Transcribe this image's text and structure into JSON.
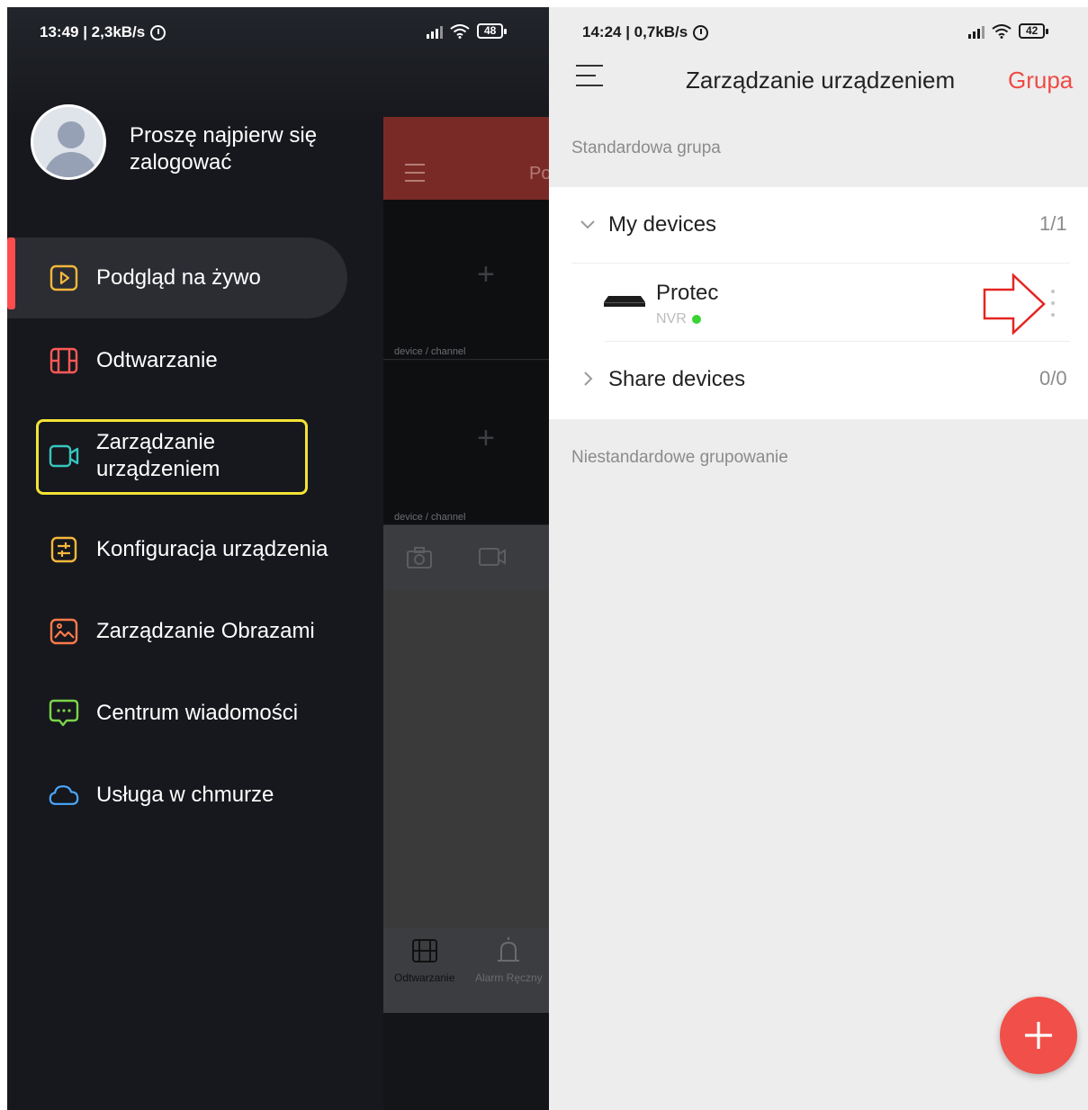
{
  "left_phone": {
    "status": {
      "time": "13:49 | 2,3kB/s",
      "battery": "48"
    },
    "profile": {
      "login_text": "Proszę najpierw się zalogować"
    },
    "menu": [
      {
        "label": "Podgląd na żywo",
        "icon": "play-square-icon",
        "color": "#f5b73b"
      },
      {
        "label": "Odtwarzanie",
        "icon": "film-icon",
        "color": "#ff5a56"
      },
      {
        "label": "Zarządzanie urządzeniem",
        "icon": "camera-icon",
        "color": "#38c6c0"
      },
      {
        "label": "Konfiguracja urządzenia",
        "icon": "sliders-icon",
        "color": "#f5b73b"
      },
      {
        "label": "Zarządzanie Obrazami",
        "icon": "image-icon",
        "color": "#ff7a4a"
      },
      {
        "label": "Centrum wiadomości",
        "icon": "chat-icon",
        "color": "#7bd44a"
      },
      {
        "label": "Usługa w chmurze",
        "icon": "cloud-icon",
        "color": "#4aa8ff"
      }
    ],
    "background_app": {
      "title_fragment": "Po",
      "panes": [
        "device / channel",
        "device / channel"
      ],
      "tabs": [
        "Odtwarzanie",
        "Alarm Ręczny"
      ]
    }
  },
  "right_phone": {
    "status": {
      "time": "14:24 | 0,7kB/s",
      "battery": "42"
    },
    "header": {
      "title": "Zarządzanie urządzeniem",
      "action": "Grupa"
    },
    "standard_group_label": "Standardowa grupa",
    "groups": [
      {
        "name": "My devices",
        "count": "1/1",
        "expanded": true
      },
      {
        "name": "Share devices",
        "count": "0/0",
        "expanded": false
      }
    ],
    "device": {
      "name": "Protec",
      "type": "NVR",
      "online": true
    },
    "custom_group_label": "Niestandardowe grupowanie",
    "accent": "#ef4b45"
  }
}
